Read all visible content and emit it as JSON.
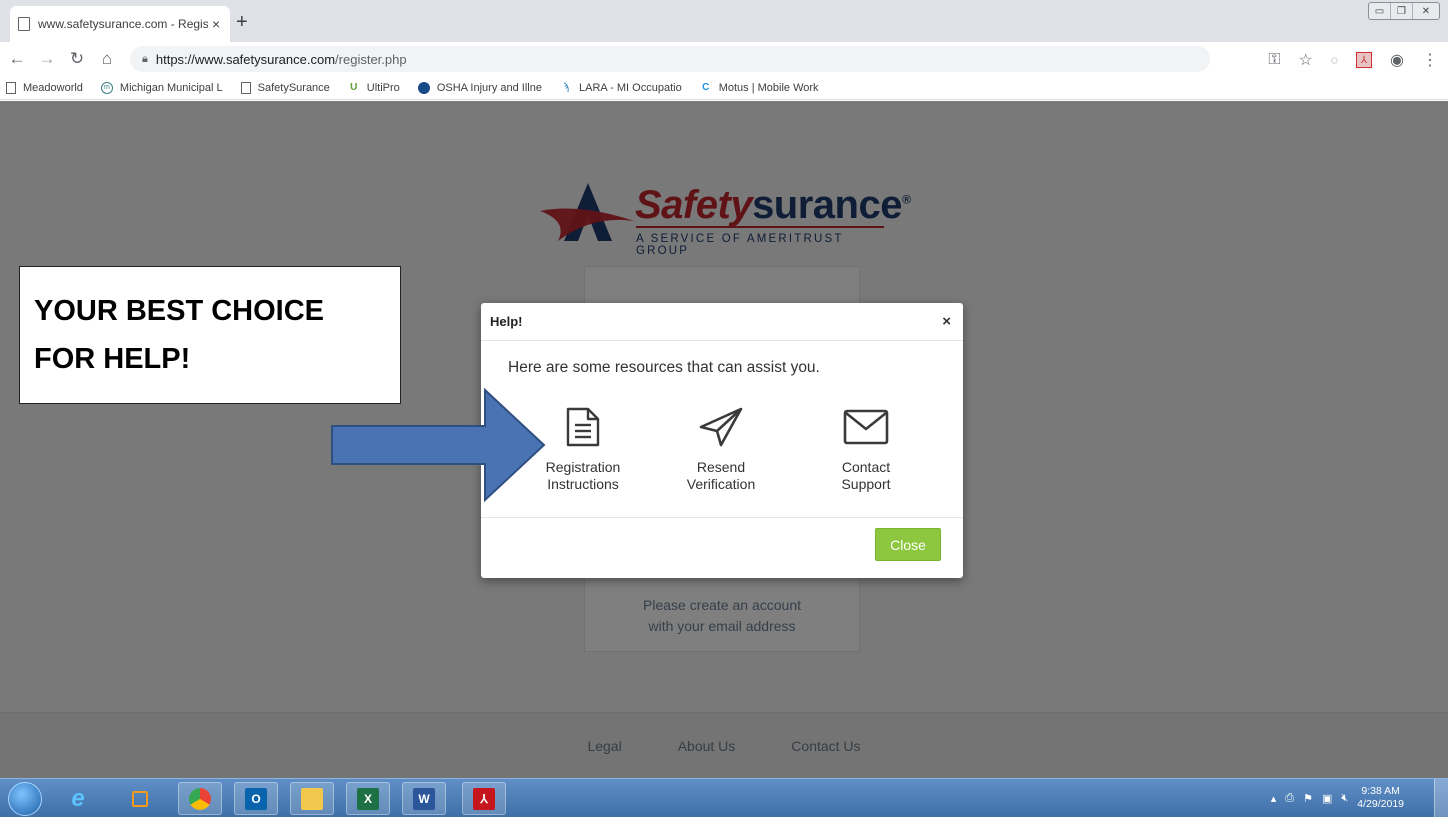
{
  "browser": {
    "tab_title": "www.safetysurance.com - Registe",
    "tab_close": "×",
    "new_tab": "+",
    "url_scheme_host": "https://www.safetysurance.com",
    "url_path": "/register.php",
    "bookmarks": [
      {
        "label": "Meadoworld",
        "icon": "page-icon"
      },
      {
        "label": "Michigan Municipal L",
        "icon": "mml-icon"
      },
      {
        "label": "SafetySurance",
        "icon": "page-icon"
      },
      {
        "label": "UltiPro",
        "icon": "ultipro-icon"
      },
      {
        "label": "OSHA Injury and Illne",
        "icon": "osha-icon"
      },
      {
        "label": "LARA - MI Occupatio",
        "icon": "lara-icon"
      },
      {
        "label": "Motus | Mobile Work",
        "icon": "motus-icon"
      }
    ]
  },
  "page": {
    "logo": {
      "word_red": "Safety",
      "word_blue": "surance",
      "reg": "®",
      "tagline": "A SERVICE OF AMERITRUST GROUP"
    },
    "card_message_line1": "Please create an account",
    "card_message_line2": "with your email address",
    "footer_links": [
      "Legal",
      "About Us",
      "Contact Us"
    ]
  },
  "modal": {
    "title": "Help!",
    "close_x": "×",
    "intro": "Here are some resources that can assist you.",
    "resources": [
      {
        "line1": "Registration",
        "line2": "Instructions",
        "icon": "document-icon"
      },
      {
        "line1": "Resend",
        "line2": "Verification",
        "icon": "paper-plane-icon"
      },
      {
        "line1": "Contact",
        "line2": "Support",
        "icon": "envelope-icon"
      }
    ],
    "close_button": "Close"
  },
  "annotation": {
    "line1": "YOUR BEST CHOICE",
    "line2": "FOR HELP!"
  },
  "taskbar": {
    "time": "9:38 AM",
    "date": "4/29/2019"
  },
  "colors": {
    "accent_green": "#8dc63f",
    "brand_red": "#c0262d",
    "brand_blue": "#1f3a6e",
    "arrow_blue": "#4a73b4"
  }
}
